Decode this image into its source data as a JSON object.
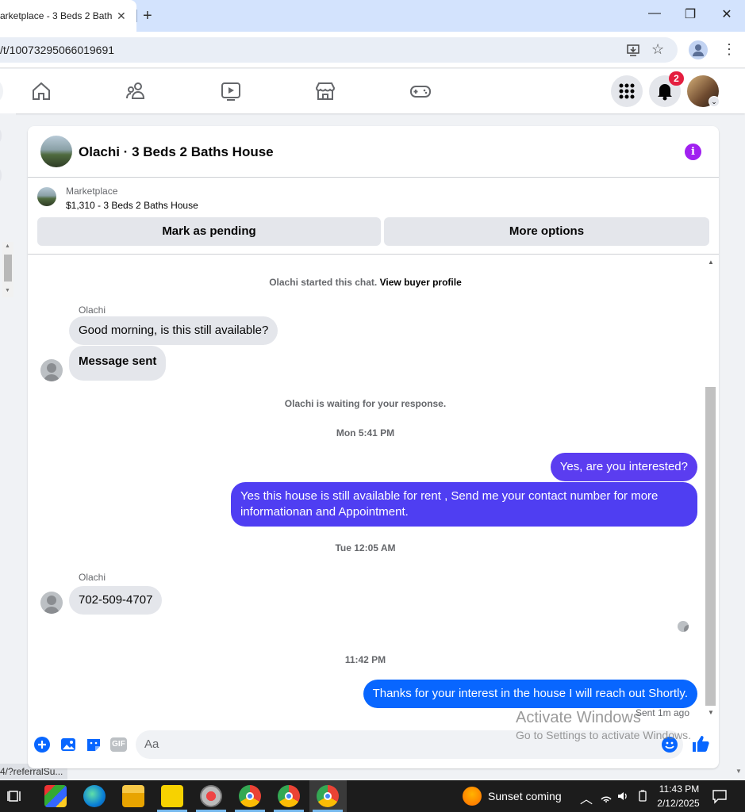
{
  "browser": {
    "tab_title": "arketplace - 3 Beds 2 Bath",
    "tab_close": "✕",
    "new_tab": "+",
    "url": "/t/10073295066019691",
    "status_url": "4/?referralSu..."
  },
  "window": {
    "minimize": "—",
    "maximize": "❐",
    "close": "✕"
  },
  "nav": {
    "notification_count": "2"
  },
  "chat": {
    "title": "Olachi · 3 Beds 2 Baths House",
    "listing_source": "Marketplace",
    "listing_title": "$1,310 - 3 Beds 2 Baths House",
    "btn_pending": "Mark as pending",
    "btn_more": "More options",
    "started_text": "Olachi started this chat.",
    "view_profile": "View buyer profile",
    "sender_name_1": "Olachi",
    "msg_1": "Good morning, is this still available?",
    "msg_2": "Message sent",
    "waiting_text": "Olachi is waiting for your response.",
    "ts_1": "Mon 5:41 PM",
    "msg_3": "Yes, are you interested?",
    "msg_4": "Yes this house is still available for rent , Send me your contact number for more informationan and Appointment.",
    "ts_2": "Tue 12:05 AM",
    "sender_name_2": "Olachi",
    "msg_5": "702-509-4707",
    "ts_3": "11:42 PM",
    "msg_6": "Thanks for your interest in the house I will reach out Shortly.",
    "sent_status": "Sent 1m ago",
    "composer_placeholder": "Aa",
    "gif_label": "GIF"
  },
  "watermark": {
    "line1": "Activate Windows",
    "line2": "Go to Settings to activate Windows."
  },
  "taskbar": {
    "weather": "Sunset coming",
    "time": "11:43 PM",
    "date": "2/12/2025"
  },
  "colors": {
    "accent": "#0866ff",
    "my_bubble": "#4e3bf0",
    "badge": "#e41e3f",
    "info": "#a020f0"
  }
}
